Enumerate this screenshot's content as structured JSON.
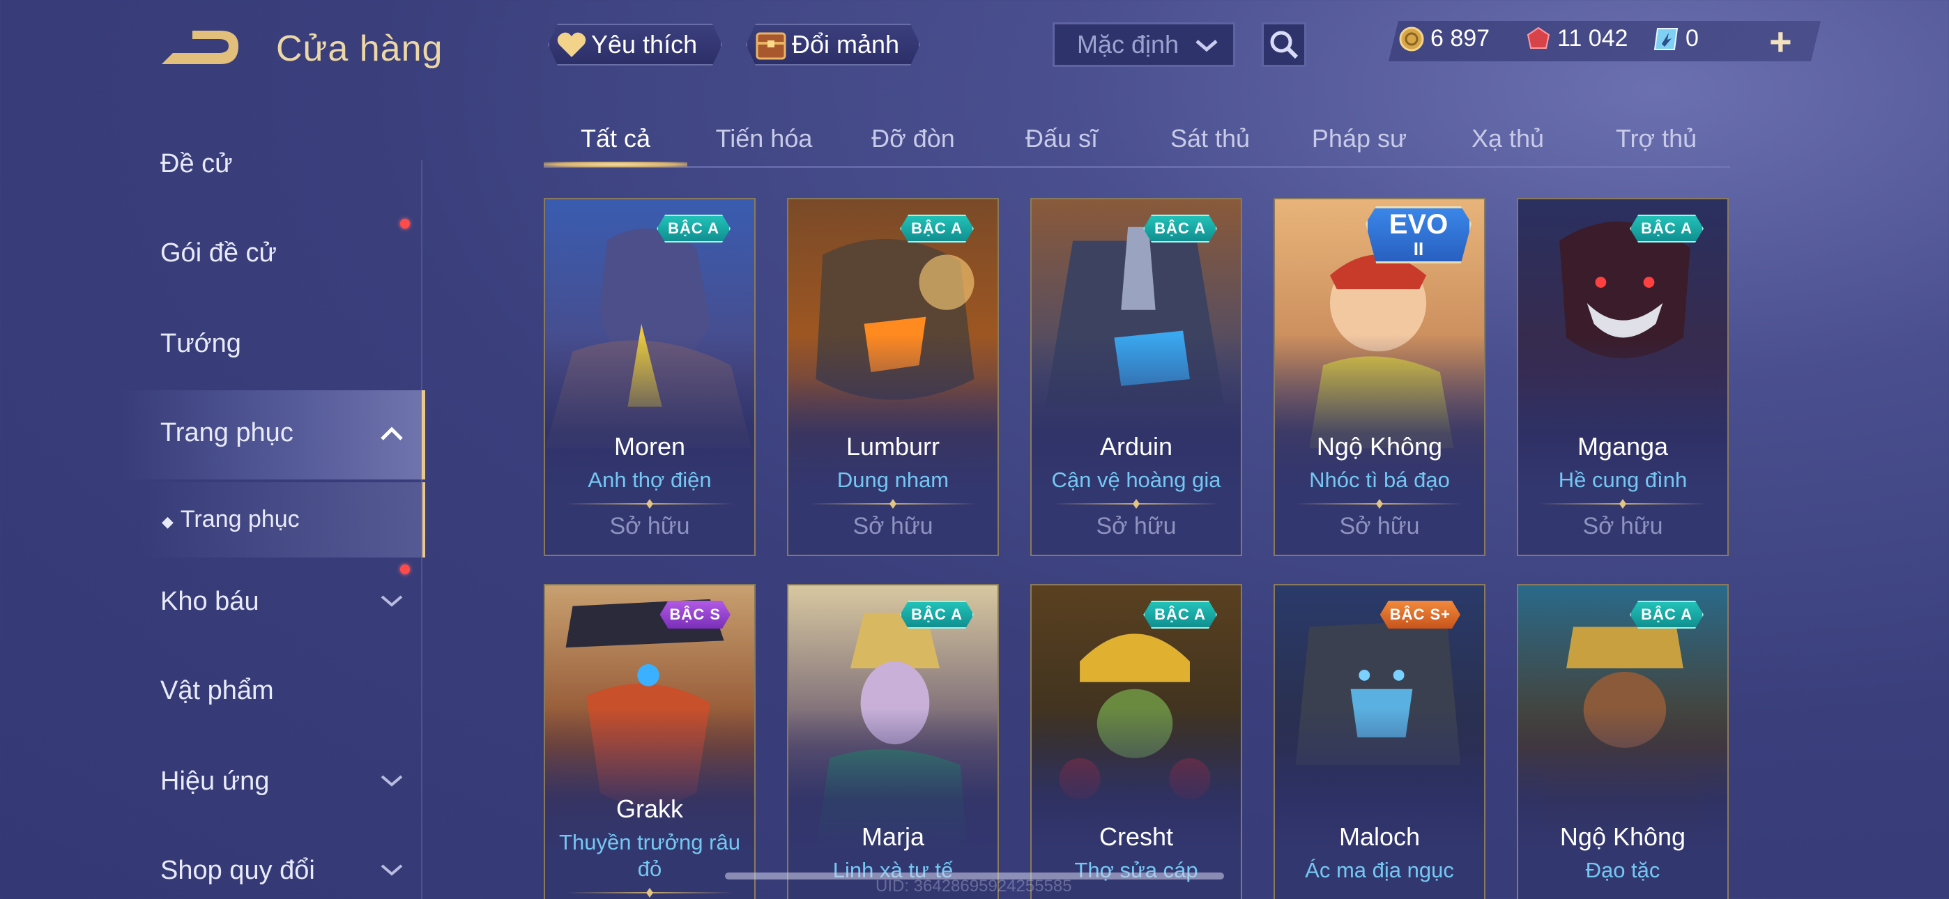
{
  "header": {
    "title": "Cửa hàng",
    "favorite_label": "Yêu thích",
    "shard_label": "Đổi mảnh",
    "sort_value": "Mặc định"
  },
  "currency": {
    "gold": "6 897",
    "ruby": "11 042",
    "tickets": "0"
  },
  "sidebar": {
    "items": [
      {
        "label": "Đề cử"
      },
      {
        "label": "Gói đề cử"
      },
      {
        "label": "Tướng"
      },
      {
        "label": "Trang phục"
      },
      {
        "label": "Trang phục"
      },
      {
        "label": "Kho báu"
      },
      {
        "label": "Vật phẩm"
      },
      {
        "label": "Hiệu ứng"
      },
      {
        "label": "Shop quy đổi"
      }
    ]
  },
  "tabs": [
    "Tất cả",
    "Tiến hóa",
    "Đỡ đòn",
    "Đấu sĩ",
    "Sát thủ",
    "Pháp sư",
    "Xạ thủ",
    "Trợ thủ"
  ],
  "cards": [
    {
      "hero": "Moren",
      "skin": "Anh thợ điện",
      "status": "Sở hữu",
      "rank": "BẬC A"
    },
    {
      "hero": "Lumburr",
      "skin": "Dung nham",
      "status": "Sở hữu",
      "rank": "BẬC A"
    },
    {
      "hero": "Arduin",
      "skin": "Cận vệ hoàng gia",
      "status": "Sở hữu",
      "rank": "BẬC A"
    },
    {
      "hero": "Ngộ Không",
      "skin": "Nhóc tì bá đạo",
      "status": "Sở hữu",
      "evo": "EVO",
      "evo_level": "II"
    },
    {
      "hero": "Mganga",
      "skin": "Hề cung đình",
      "status": "Sở hữu",
      "rank": "BẬC A"
    },
    {
      "hero": "Grakk",
      "skin": "Thuyền trưởng râu đỏ",
      "rank": "BẬC S"
    },
    {
      "hero": "Marja",
      "skin": "Linh xà tư tế",
      "rank": "BẬC A"
    },
    {
      "hero": "Cresht",
      "skin": "Thợ sửa cáp",
      "rank": "BẬC A"
    },
    {
      "hero": "Maloch",
      "skin": "Ác ma địa ngục",
      "rank": "BẬC S+"
    },
    {
      "hero": "Ngộ Không",
      "skin": "Đạo tặc",
      "rank": "BẬC A"
    }
  ],
  "footer": {
    "uid": "UID: 36428695924255585"
  },
  "colors": {
    "background": "#3a3f7c",
    "title_gold": "#ecd7a6",
    "skin_name_blue": "#74c8f2",
    "rank_a": "#1fb5ad",
    "rank_s": "#9b47d8",
    "rank_splus": "#e27030",
    "notification_red": "#ff4a4a"
  }
}
